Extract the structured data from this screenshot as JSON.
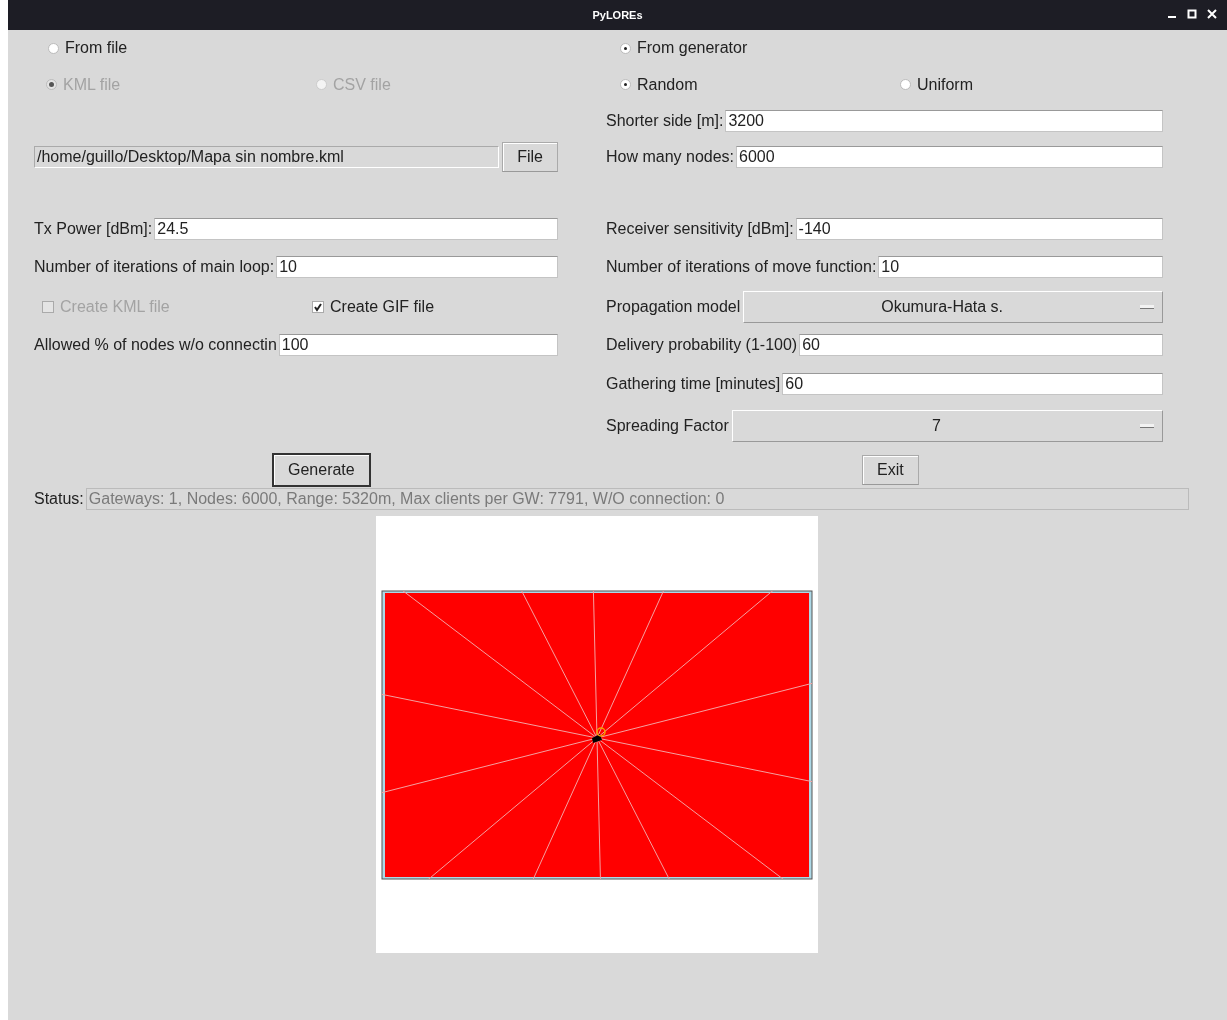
{
  "window": {
    "title": "PyLOREs"
  },
  "source_options": [
    {
      "label": "From file",
      "selected": false
    },
    {
      "label": "From generator",
      "selected": true
    }
  ],
  "file_type_options": [
    {
      "label": "KML file",
      "selected": true,
      "disabled": true
    },
    {
      "label": "CSV file",
      "selected": false,
      "disabled": true
    }
  ],
  "distribution_options": [
    {
      "label": "Random",
      "selected": true,
      "disabled": false
    },
    {
      "label": "Uniform",
      "selected": false,
      "disabled": false
    }
  ],
  "generator_fields": [
    {
      "label": "Shorter side [m]:",
      "value": "3200"
    },
    {
      "label": "How many nodes:",
      "value": "6000"
    }
  ],
  "file_path": {
    "value": "/home/guillo/Desktop/Mapa sin nombre.kml",
    "readonly": true
  },
  "file_button": "File",
  "left_fields": [
    {
      "label": "Tx Power [dBm]:",
      "value": "24.5"
    },
    {
      "label": "Number of iterations of main loop:",
      "value": "10"
    }
  ],
  "checkboxes": [
    {
      "label": "Create KML file",
      "checked": false,
      "disabled": true
    },
    {
      "label": "Create GIF file",
      "checked": true,
      "disabled": false
    }
  ],
  "allowed_field": {
    "label": "Allowed % of nodes w/o connectin",
    "value": "100"
  },
  "right_fields": [
    {
      "label": "Receiver sensitivity [dBm]:",
      "value": "-140"
    },
    {
      "label": "Number of iterations of move function:",
      "value": "10"
    }
  ],
  "propagation_model": {
    "label": "Propagation model",
    "value": "Okumura-Hata s."
  },
  "right_fields_2": [
    {
      "label": "Delivery probability (1-100)",
      "value": "60"
    },
    {
      "label": "Gathering time [minutes]",
      "value": "60"
    }
  ],
  "spreading_factor": {
    "label": "Spreading Factor",
    "value": "7"
  },
  "buttons": [
    {
      "label": "Generate",
      "default": true
    },
    {
      "label": "Exit",
      "default": false
    }
  ],
  "status": {
    "label": "Status:",
    "value": "Gateways: 1, Nodes: 6000, Range: 5320m, Max clients per GW: 7791, W/O connection: 0"
  }
}
